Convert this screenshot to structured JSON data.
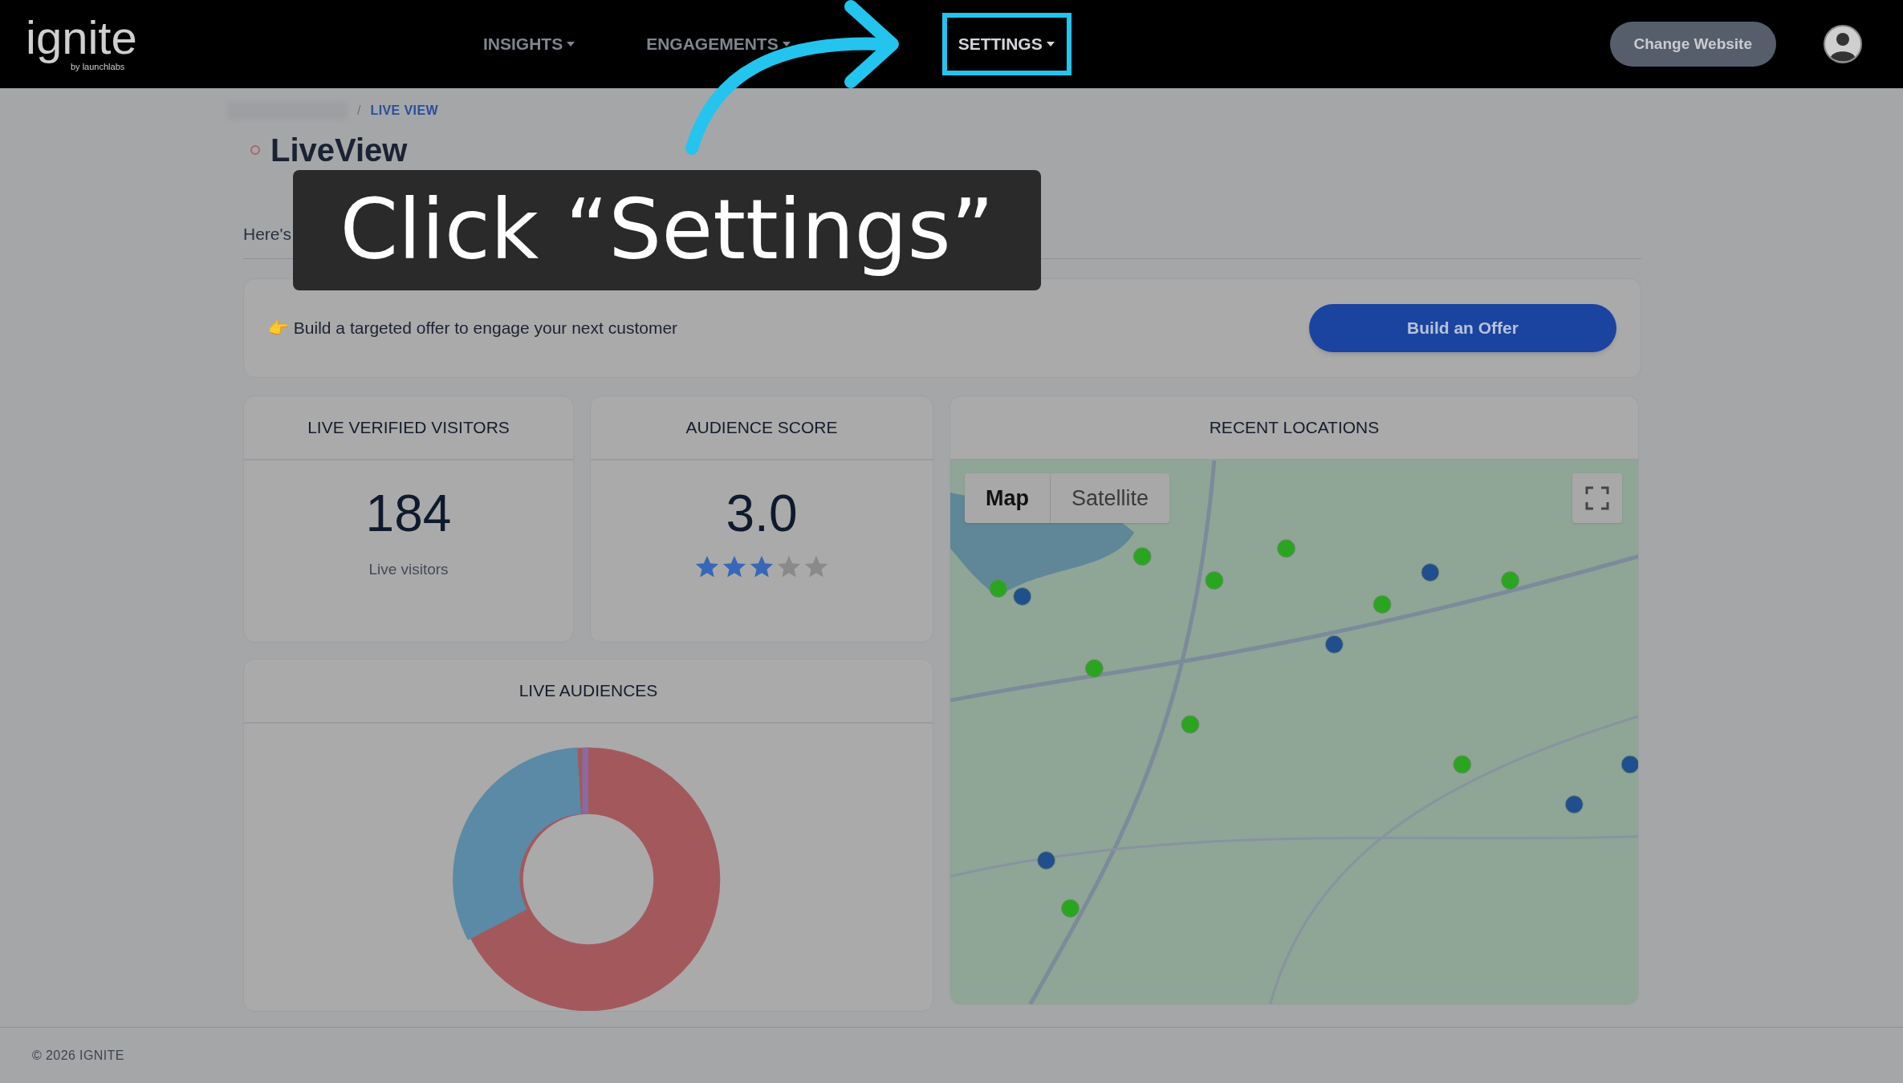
{
  "header": {
    "logo": "ignite",
    "logo_sub": "by launchlabs",
    "nav": [
      {
        "label": "INSIGHTS",
        "selected": false
      },
      {
        "label": "ENGAGEMENTS",
        "selected": false
      },
      {
        "label": "SETTINGS",
        "selected": true
      }
    ],
    "change_website": "Change Website"
  },
  "breadcrumb": {
    "separator": "/",
    "current": "LIVE VIEW"
  },
  "page": {
    "title": "LiveView",
    "description": "Here's"
  },
  "offer": {
    "emoji": "👉",
    "text": "Build a targeted offer to engage your next customer",
    "button": "Build an Offer"
  },
  "cards": [
    {
      "title": "LIVE VERIFIED VISITORS",
      "value": "184",
      "caption": "Live visitors"
    },
    {
      "title": "AUDIENCE SCORE",
      "value": "3.0",
      "stars": 3
    }
  ],
  "map": {
    "title": "RECENT LOCATIONS",
    "tabs": [
      {
        "label": "Map",
        "selected": true
      },
      {
        "label": "Satellite",
        "selected": false
      }
    ]
  },
  "audiences": {
    "title": "LIVE AUDIENCES"
  },
  "callout": {
    "text": "Click “Settings”"
  },
  "footer": "© 2026 IGNITE"
}
